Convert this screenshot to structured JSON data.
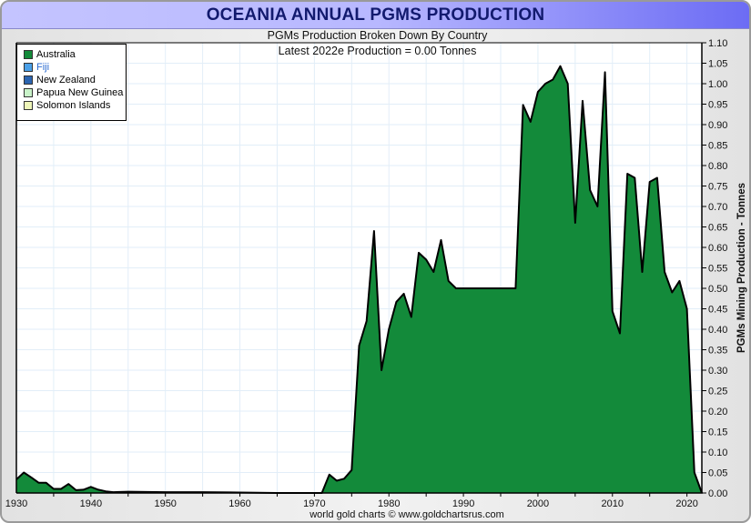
{
  "title": "OCEANIA ANNUAL PGMS PRODUCTION",
  "credit": "world gold charts © www.goldchartsrus.com",
  "legend": [
    {
      "label": "Australia",
      "color": "#138a3a"
    },
    {
      "label": "Fiji",
      "color": "#4aa0e8"
    },
    {
      "label": "New Zealand",
      "color": "#2b64b0"
    },
    {
      "label": "Papua New Guinea",
      "color": "#c8f2c8"
    },
    {
      "label": "Solomon Islands",
      "color": "#eef5b8"
    }
  ],
  "chart_data": {
    "type": "area",
    "title": "PGMs Production Broken Down By Country",
    "subtitle": "Latest 2022e  Production = 0.00 Tonnes",
    "ylabel": "PGMs Mining Production - Tonnes",
    "xlabel": "",
    "xlim": [
      1930,
      2022
    ],
    "ylim": [
      0,
      1.1
    ],
    "x_ticks": [
      "1930",
      "1940",
      "1950",
      "1960",
      "1970",
      "1980",
      "1990",
      "2000",
      "2010",
      "2020"
    ],
    "y_ticks": [
      "0.00",
      "0.05",
      "0.10",
      "0.15",
      "0.20",
      "0.25",
      "0.30",
      "0.35",
      "0.40",
      "0.45",
      "0.50",
      "0.55",
      "0.60",
      "0.65",
      "0.70",
      "0.75",
      "0.80",
      "0.85",
      "0.90",
      "0.95",
      "1.00",
      "1.05",
      "1.10"
    ],
    "grid": true,
    "legend_position": "top-left",
    "series": [
      {
        "name": "Australia",
        "color": "#138a3a",
        "x": [
          1930,
          1931,
          1932,
          1933,
          1934,
          1935,
          1936,
          1937,
          1938,
          1939,
          1940,
          1941,
          1942,
          1943,
          1945,
          1950,
          1955,
          1960,
          1965,
          1971,
          1972,
          1973,
          1974,
          1975,
          1976,
          1977,
          1978,
          1979,
          1980,
          1981,
          1982,
          1983,
          1984,
          1985,
          1986,
          1987,
          1988,
          1989,
          1990,
          1991,
          1992,
          1993,
          1994,
          1995,
          1996,
          1997,
          1998,
          1999,
          2000,
          2001,
          2002,
          2003,
          2004,
          2005,
          2006,
          2007,
          2008,
          2009,
          2010,
          2011,
          2012,
          2013,
          2014,
          2015,
          2016,
          2017,
          2018,
          2019,
          2020,
          2021,
          2022
        ],
        "values": [
          0.033,
          0.05,
          0.038,
          0.025,
          0.025,
          0.01,
          0.01,
          0.022,
          0.007,
          0.008,
          0.015,
          0.008,
          0.004,
          0.002,
          0.003,
          0.002,
          0.002,
          0.001,
          0.0,
          0.0,
          0.045,
          0.03,
          0.035,
          0.056,
          0.36,
          0.42,
          0.64,
          0.3,
          0.4,
          0.467,
          0.487,
          0.43,
          0.587,
          0.57,
          0.54,
          0.618,
          0.518,
          0.5,
          0.5,
          0.5,
          0.5,
          0.5,
          0.5,
          0.5,
          0.5,
          0.5,
          0.948,
          0.907,
          0.98,
          1.0,
          1.01,
          1.043,
          1.0,
          0.66,
          0.958,
          0.74,
          0.7,
          1.028,
          0.444,
          0.39,
          0.78,
          0.77,
          0.54,
          0.76,
          0.77,
          0.54,
          0.49,
          0.518,
          0.45,
          0.05,
          0.0
        ]
      }
    ]
  }
}
